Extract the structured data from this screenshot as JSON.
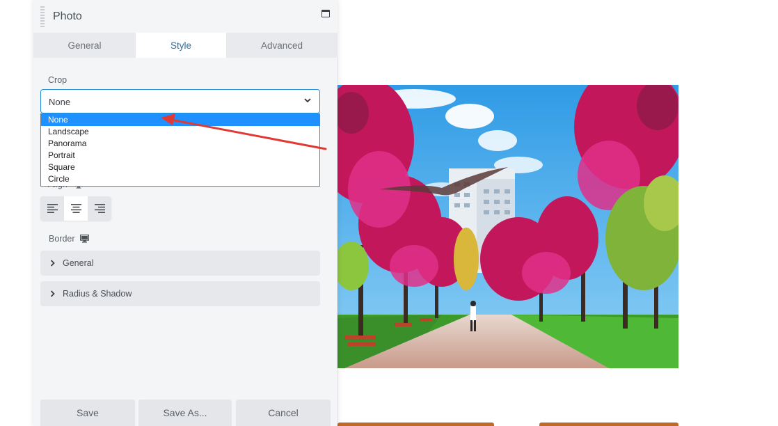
{
  "panel": {
    "title": "Photo",
    "tabs": [
      "General",
      "Style",
      "Advanced"
    ],
    "active_tab": "Style"
  },
  "crop": {
    "label": "Crop",
    "selected": "None",
    "options": [
      "None",
      "Landscape",
      "Panorama",
      "Portrait",
      "Square",
      "Circle"
    ]
  },
  "align": {
    "label": "Align",
    "buttons": [
      "align-left",
      "align-center",
      "align-right"
    ],
    "active": "align-center"
  },
  "border": {
    "label": "Border",
    "sections": [
      "General",
      "Radius & Shadow"
    ]
  },
  "footer": {
    "save": "Save",
    "save_as": "Save As...",
    "cancel": "Cancel"
  },
  "colors": {
    "accent": "#1e8fd6",
    "selected_option": "#1e90ff",
    "annotation_arrow": "#e03a36"
  }
}
